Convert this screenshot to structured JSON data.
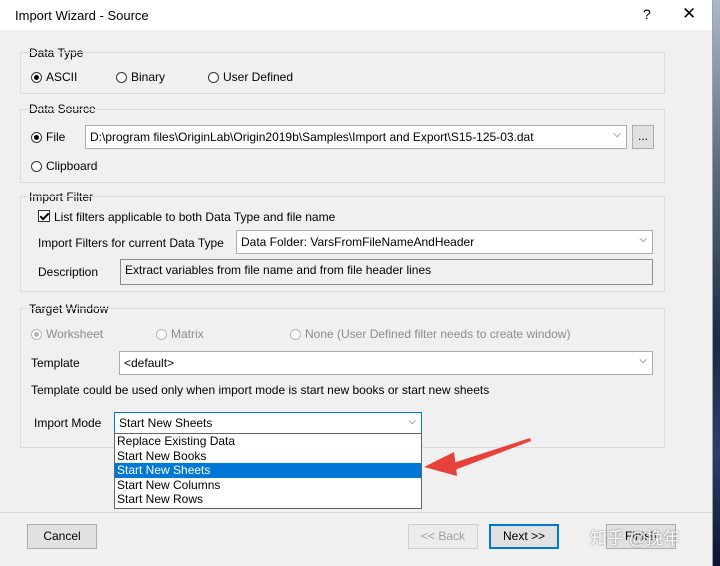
{
  "window": {
    "title": "Import Wizard - Source",
    "help_label": "?",
    "close_label": "✕"
  },
  "data_type": {
    "label": "Data Type",
    "options": [
      "ASCII",
      "Binary",
      "User Defined"
    ],
    "selected": "ASCII"
  },
  "data_source": {
    "label": "Data Source",
    "file_label": "File",
    "file_path": "D:\\program files\\OriginLab\\Origin2019b\\Samples\\Import and Export\\S15-125-03.dat",
    "browse_label": "...",
    "clipboard_label": "Clipboard",
    "selected": "File"
  },
  "import_filter": {
    "label": "Import Filter",
    "checkbox_label": "List filters applicable to both Data Type and file name",
    "checkbox_checked": true,
    "filters_label": "Import Filters for current Data Type",
    "filters_value": "Data Folder: VarsFromFileNameAndHeader",
    "description_label": "Description",
    "description_value": "Extract variables from file name and from file header lines"
  },
  "target_window": {
    "label": "Target Window",
    "options": [
      "Worksheet",
      "Matrix",
      "None (User Defined filter needs to create window)"
    ],
    "selected": "Worksheet",
    "template_label": "Template",
    "template_value": "<default>",
    "note": "Template could be used only when import mode is start new books or start new sheets",
    "import_mode_label": "Import Mode",
    "import_mode_value": "Start New Sheets",
    "import_mode_options": [
      "Replace Existing Data",
      "Start New Books",
      "Start New Sheets",
      "Start New Columns",
      "Start New Rows"
    ]
  },
  "footer": {
    "cancel_label": "Cancel",
    "back_label": "<< Back",
    "next_label": "Next >>",
    "finish_label": "Finish"
  },
  "watermark": "知乎 @挽年",
  "colors": {
    "selection": "#0078d7",
    "arrow": "#e8413a"
  }
}
